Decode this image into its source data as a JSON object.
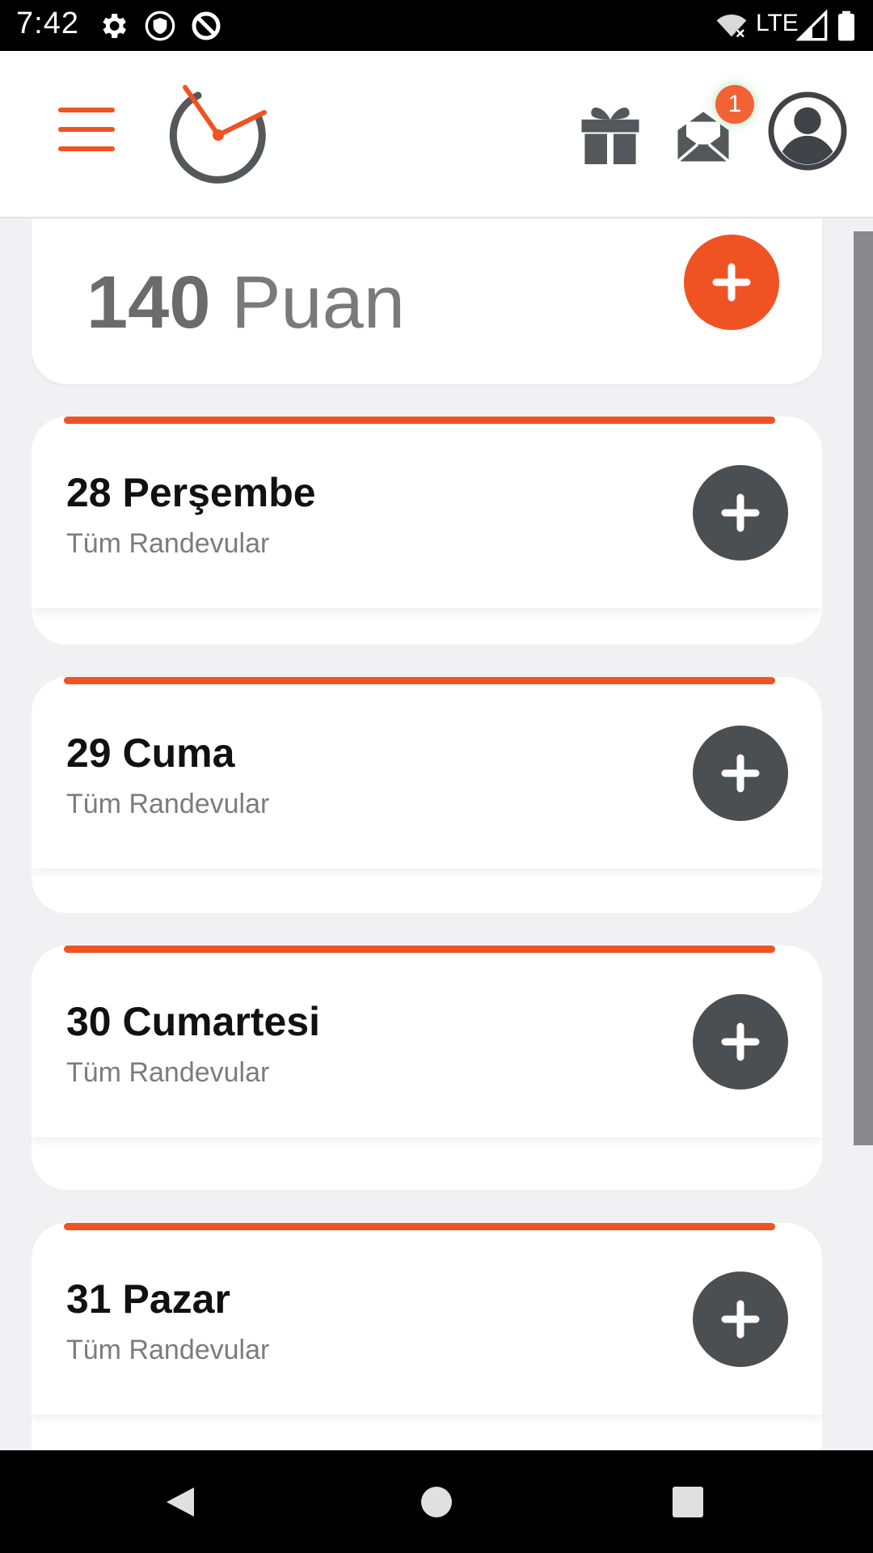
{
  "status_bar": {
    "time": "7:42",
    "network": "LTE",
    "icons": [
      "gear-icon",
      "shield-icon",
      "sync-icon",
      "wifi-off-icon",
      "signal-icon",
      "battery-icon"
    ]
  },
  "header": {
    "menu_icon": "hamburger-menu-icon",
    "logo_icon": "clock-logo-icon",
    "gift_icon": "gift-icon",
    "mail_icon": "mail-open-icon",
    "notification_count": "1",
    "profile_icon": "user-avatar-icon"
  },
  "points": {
    "value": "140",
    "unit": "Puan"
  },
  "days": [
    {
      "title": "28 Perşembe",
      "subtitle": "Tüm Randevular"
    },
    {
      "title": "29 Cuma",
      "subtitle": "Tüm Randevular"
    },
    {
      "title": "30 Cumartesi",
      "subtitle": "Tüm Randevular"
    },
    {
      "title": "31 Pazar",
      "subtitle": "Tüm Randevular"
    }
  ],
  "colors": {
    "accent": "#f05323",
    "dark_button": "#4c4f52",
    "icon_gray": "#55575b"
  },
  "nav": [
    "back-icon",
    "home-icon",
    "recents-icon"
  ]
}
